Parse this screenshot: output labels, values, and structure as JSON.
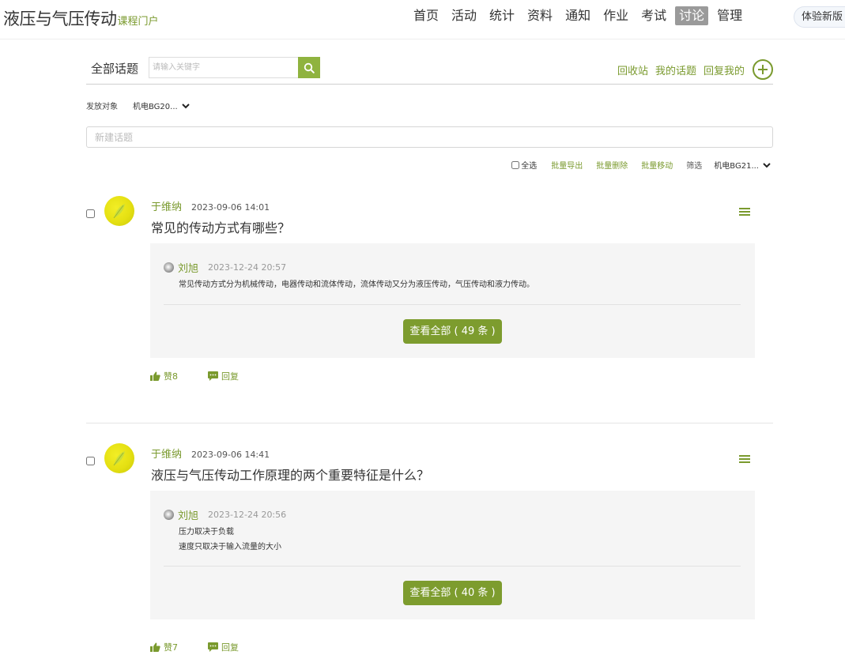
{
  "header": {
    "title": "液压与气压传动",
    "subtitle": "课程门户",
    "nav": [
      "首页",
      "活动",
      "统计",
      "资料",
      "通知",
      "作业",
      "考试",
      "讨论",
      "管理"
    ],
    "active_nav": "讨论",
    "try_new": "体验新版"
  },
  "topic_header": {
    "all_topics": "全部话题",
    "search_placeholder": "请输入关键字",
    "links": {
      "recycle": "回收站",
      "my_topics": "我的话题",
      "replies_to_me": "回复我的"
    }
  },
  "target": {
    "label": "发放对象",
    "value": "机电BG20..."
  },
  "new_topic_placeholder": "新建话题",
  "batch": {
    "select_all": "全选",
    "export": "批量导出",
    "delete": "批量删除",
    "move": "批量移动",
    "filter_label": "筛选",
    "filter_value": "机电BG21..."
  },
  "topics": [
    {
      "author": "于维纳",
      "time": "2023-09-06 14:01",
      "title": "常见的传动方式有哪些？",
      "reply": {
        "author": "刘旭",
        "time": "2023-12-24 20:57",
        "lines": [
          "常见传动方式分为机械传动，电器传动和流体传动，流体传动又分为液压传动，气压传动和液力传动。"
        ]
      },
      "view_all": "查看全部 ( 49 条 )",
      "likes": "赞8",
      "reply_label": "回复"
    },
    {
      "author": "于维纳",
      "time": "2023-09-06 14:41",
      "title": "液压与气压传动工作原理的两个重要特征是什么？",
      "reply": {
        "author": "刘旭",
        "time": "2023-12-24 20:56",
        "lines": [
          "压力取决于负载",
          "速度只取决于输入流量的大小"
        ]
      },
      "view_all": "查看全部 ( 40 条 )",
      "likes": "赞7",
      "reply_label": "回复"
    }
  ],
  "colors": {
    "accent": "#7a9a2e",
    "button": "#7d9c2e",
    "search_button": "#8fb33f",
    "active_nav_bg": "#9a9a9a",
    "reply_bg": "#f5f5f5"
  }
}
